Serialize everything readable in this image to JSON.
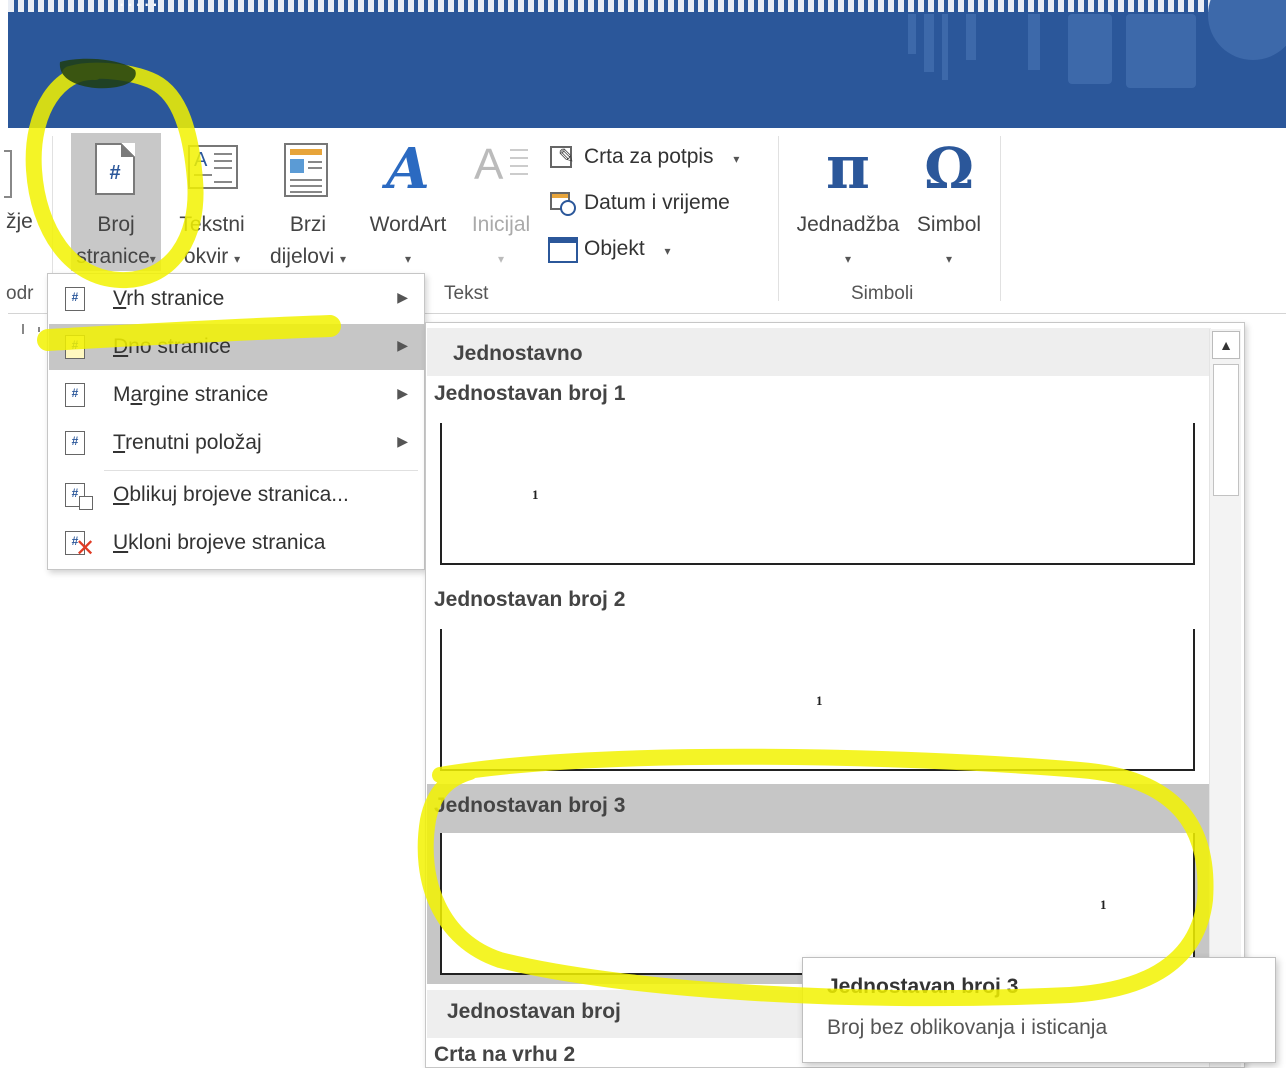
{
  "titlebar": {
    "partial_text": "·····"
  },
  "ribbon": {
    "left_cut_label": "žje",
    "left_cut_group": "odr",
    "broj_stranice": {
      "line1": "Broj",
      "line2": "stranice"
    },
    "tekstni_okvir": {
      "line1": "Tekstni",
      "line2": "okvir"
    },
    "brzi_dijelovi": {
      "line1": "Brzi",
      "line2": "dijelovi"
    },
    "wordart": {
      "line1": "WordArt"
    },
    "inicijal": {
      "line1": "Inicijal"
    },
    "crta_za_potpis": "Crta za potpis",
    "datum_i_vrijeme": "Datum i vrijeme",
    "objekt": "Objekt",
    "jednadzba": {
      "line1": "Jednadžba",
      "glyph": "π"
    },
    "simbol": {
      "line1": "Simbol",
      "glyph": "Ω"
    },
    "groups": {
      "tekst": "Tekst",
      "simboli": "Simboli"
    },
    "dropdown_arrow": "▾"
  },
  "menu": {
    "items": [
      {
        "underline": "V",
        "rest": "rh stranice",
        "has_submenu": true,
        "icon": "page-top-number-icon"
      },
      {
        "underline": "D",
        "rest": "no stranice",
        "has_submenu": true,
        "active": true,
        "icon": "page-bottom-number-icon"
      },
      {
        "underline": "",
        "pre": "M",
        "mid": "a",
        "rest": "rgine stranice",
        "has_submenu": true,
        "icon": "page-margin-number-icon"
      },
      {
        "underline": "T",
        "rest": "renutni položaj",
        "has_submenu": true,
        "icon": "current-position-number-icon"
      },
      {
        "underline": "O",
        "rest": "blikuj brojeve stranica...",
        "has_submenu": false,
        "icon": "format-page-numbers-icon"
      },
      {
        "underline": "U",
        "rest": "kloni brojeve stranica",
        "has_submenu": false,
        "icon": "remove-page-numbers-icon"
      }
    ],
    "submenu_arrow": "▶"
  },
  "gallery": {
    "header1": "Jednostavno",
    "items": [
      {
        "title": "Jednostavan broj 1",
        "number": "1",
        "align": "left"
      },
      {
        "title": "Jednostavan broj 2",
        "number": "1",
        "align": "center"
      },
      {
        "title": "Jednostavan broj 3",
        "number": "1",
        "align": "right",
        "selected": true
      }
    ],
    "header2": "Jednostavan broj",
    "next_title": "Crta na vrhu 2",
    "scroll_up": "▲"
  },
  "tooltip": {
    "title": "Jednostavan broj 3",
    "description": "Broj bez oblikovanja i isticanja"
  },
  "colors": {
    "title_bar": "#2b579a",
    "highlighter": "#f5f500",
    "selected": "#c6c6c6",
    "wordart": "#2b6ac1"
  }
}
